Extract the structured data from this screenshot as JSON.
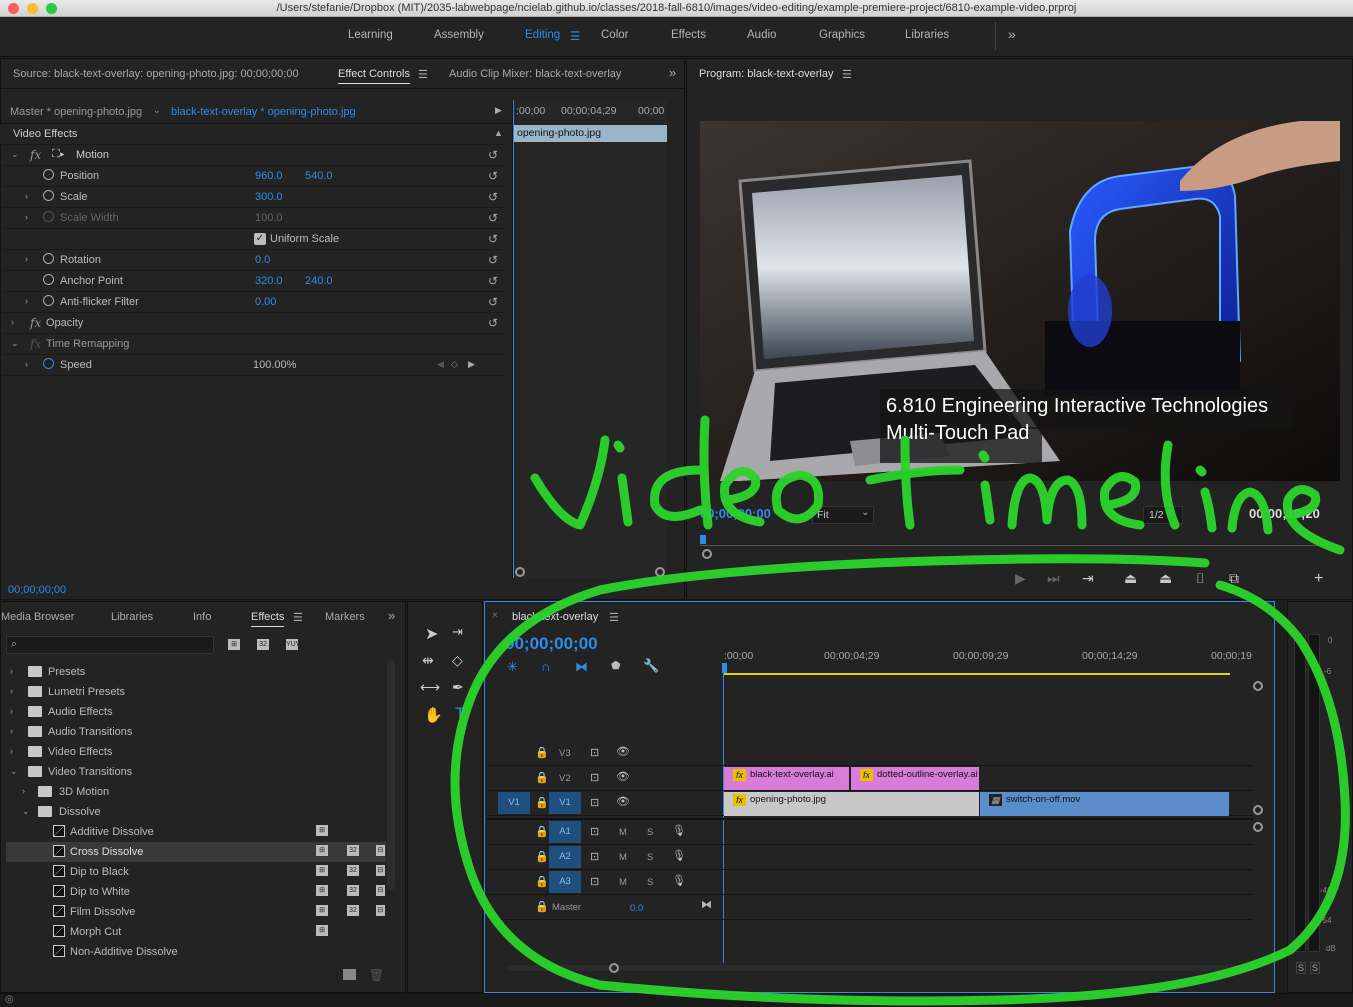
{
  "window": {
    "title": "/Users/stefanie/Dropbox (MIT)/2035-labwebpage/ncielab.github.io/classes/2018-fall-6810/images/video-editing/example-premiere-project/6810-example-video.prproj"
  },
  "workspaces": {
    "items": [
      "Learning",
      "Assembly",
      "Editing",
      "Color",
      "Effects",
      "Audio",
      "Graphics",
      "Libraries"
    ],
    "active": "Editing",
    "overflow": "»"
  },
  "source_panel": {
    "tabs": [
      "Source: black-text-overlay: opening-photo.jpg: 00;00;00;00",
      "Effect Controls",
      "Audio Clip Mixer: black-text-overlay"
    ],
    "active_tab": "Effect Controls",
    "master_label": "Master * opening-photo.jpg",
    "sequence_label": "black-text-overlay * opening-photo.jpg",
    "section": "Video Effects",
    "mini_ruler": [
      ":00;00",
      "00;00;04;29",
      "00;00"
    ],
    "mini_clip": "opening-photo.jpg",
    "timecode": "00;00;00;00",
    "properties": {
      "motion": "Motion",
      "position": {
        "label": "Position",
        "x": "960.0",
        "y": "540.0"
      },
      "scale": {
        "label": "Scale",
        "value": "300.0"
      },
      "scale_width": {
        "label": "Scale Width",
        "value": "100.0"
      },
      "uniform_scale": {
        "label": "Uniform Scale",
        "checked": true
      },
      "rotation": {
        "label": "Rotation",
        "value": "0.0"
      },
      "anchor_point": {
        "label": "Anchor Point",
        "x": "320.0",
        "y": "240.0"
      },
      "anti_flicker": {
        "label": "Anti-flicker Filter",
        "value": "0.00"
      },
      "opacity": "Opacity",
      "time_remapping": "Time Remapping",
      "speed": {
        "label": "Speed",
        "value": "100.00%"
      }
    }
  },
  "program_panel": {
    "title": "Program: black-text-overlay",
    "overlay_line1": "6.810 Engineering Interactive Technologies",
    "overlay_line2": "Multi-Touch Pad",
    "timecode_left": "00;00;00;00",
    "zoom": "Fit",
    "resolution": "1/2",
    "timecode_right": "00;00;19;20"
  },
  "effects_panel": {
    "tabs": [
      "Media Browser",
      "Libraries",
      "Info",
      "Effects",
      "Markers"
    ],
    "active_tab": "Effects",
    "search_placeholder": "",
    "badges": [
      "32",
      "32",
      "YUV"
    ],
    "tree": [
      {
        "label": "Presets",
        "level": 0,
        "type": "folder",
        "expanded": false
      },
      {
        "label": "Lumetri Presets",
        "level": 0,
        "type": "folder",
        "expanded": false
      },
      {
        "label": "Audio Effects",
        "level": 0,
        "type": "folder",
        "expanded": false
      },
      {
        "label": "Audio Transitions",
        "level": 0,
        "type": "folder",
        "expanded": false
      },
      {
        "label": "Video Effects",
        "level": 0,
        "type": "folder",
        "expanded": false
      },
      {
        "label": "Video Transitions",
        "level": 0,
        "type": "folder",
        "expanded": true
      },
      {
        "label": "3D Motion",
        "level": 1,
        "type": "folder",
        "expanded": false
      },
      {
        "label": "Dissolve",
        "level": 1,
        "type": "folder",
        "expanded": true
      },
      {
        "label": "Additive Dissolve",
        "level": 2,
        "type": "effect"
      },
      {
        "label": "Cross Dissolve",
        "level": 2,
        "type": "effect",
        "selected": true
      },
      {
        "label": "Dip to Black",
        "level": 2,
        "type": "effect"
      },
      {
        "label": "Dip to White",
        "level": 2,
        "type": "effect"
      },
      {
        "label": "Film Dissolve",
        "level": 2,
        "type": "effect"
      },
      {
        "label": "Morph Cut",
        "level": 2,
        "type": "effect"
      },
      {
        "label": "Non-Additive Dissolve",
        "level": 2,
        "type": "effect"
      }
    ]
  },
  "timeline": {
    "sequence_name": "black-text-overlay",
    "timecode": "00;00;00;00",
    "ruler": [
      ":00;00",
      "00;00;04;29",
      "00;00;09;29",
      "00;00;14;29",
      "00;00;19"
    ],
    "video_tracks": [
      "V3",
      "V2",
      "V1"
    ],
    "source_patch": "V1",
    "audio_tracks": [
      "A1",
      "A2",
      "A3"
    ],
    "audio_buttons": {
      "mute": "M",
      "solo": "S"
    },
    "master_label": "Master",
    "master_value": "0.0",
    "clips": {
      "v2_a": "black-text-overlay.ai",
      "v2_b": "dotted-outline-overlay.ai",
      "v1_a": "opening-photo.jpg",
      "v1_b": "switch-on-off.mov"
    },
    "clip_colors": {
      "graphic": "#d97bd8",
      "still": "#c8c8c8",
      "video": "#5b8dcc"
    },
    "meter_scale": [
      "0",
      "-6",
      "-48",
      "-54",
      "dB"
    ],
    "meter_buttons": [
      "S",
      "S"
    ]
  },
  "annotation": {
    "text": "video timeline",
    "color": "#2bd42b"
  }
}
